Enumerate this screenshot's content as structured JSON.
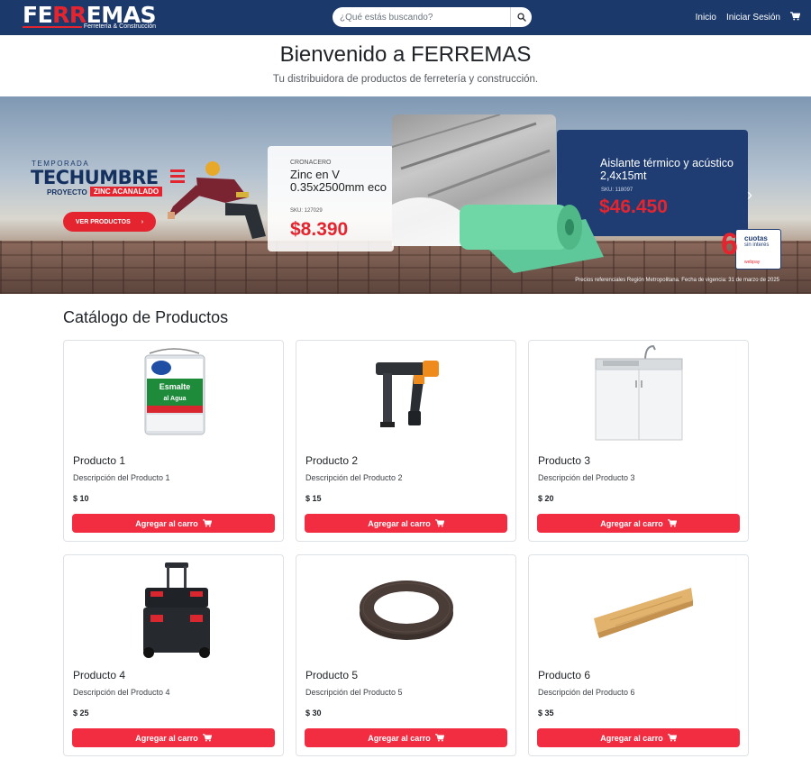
{
  "navbar": {
    "logo_text_white": "FE",
    "logo_text_red": "RR",
    "logo_text_rest": "EMAS",
    "logo_subtitle": "Ferretería & Construcción",
    "search_placeholder": "¿Qué estás buscando?",
    "search_icon": "search-icon",
    "links": [
      "Inicio",
      "Iniciar Sesión"
    ],
    "cart_icon": "cart-icon",
    "background_color": "#1b3a6b"
  },
  "hero": {
    "title": "Bienvenido a FERREMAS",
    "subtitle": "Tu distribuidora de productos de ferretería y construcción."
  },
  "banner": {
    "season": "TEMPORADA",
    "brand": "TECHUMBRE",
    "project": "PROYECTO",
    "project_tag": "ZINC ACANALADO",
    "cta": "VER PRODUCTOS",
    "cta_arrow": "›",
    "product1": {
      "brand": "CRONACERO",
      "name": "Zinc en V 0.35x2500mm eco",
      "sku": "SKU: 127029",
      "price": "$8.390"
    },
    "product2": {
      "name": "Aislante térmico y acústico 2,4x15mt",
      "sku": "SKU: 118097",
      "price": "$46.450"
    },
    "cuotas_number": "6",
    "cuotas_title": "cuotas",
    "cuotas_subtitle": "sin interés",
    "cuotas_payment": "webpay",
    "disclaimer": "Precios referenciales Región Metropolitana. Fecha de vigencia: 31 de marzo de 2025",
    "next_icon": "chevron-right-icon"
  },
  "catalog": {
    "title": "Catálogo de Productos",
    "button_label": "Agregar al carro",
    "button_icon": "cart-icon",
    "accent_color": "#f22c41",
    "products": [
      {
        "title": "Producto 1",
        "description": "Descripción del Producto 1",
        "price": "$ 10",
        "image": "paint-can"
      },
      {
        "title": "Producto 2",
        "description": "Descripción del Producto 2",
        "price": "$ 15",
        "image": "nail-gun"
      },
      {
        "title": "Producto 3",
        "description": "Descripción del Producto 3",
        "price": "$ 20",
        "image": "kitchen-sink-cabinet"
      },
      {
        "title": "Producto 4",
        "description": "Descripción del Producto 4",
        "price": "$ 25",
        "image": "rolling-tool-box"
      },
      {
        "title": "Producto 5",
        "description": "Descripción del Producto 5",
        "price": "$ 30",
        "image": "edge-banding-roll"
      },
      {
        "title": "Producto 6",
        "description": "Descripción del Producto 6",
        "price": "$ 35",
        "image": "wood-plank"
      }
    ]
  }
}
